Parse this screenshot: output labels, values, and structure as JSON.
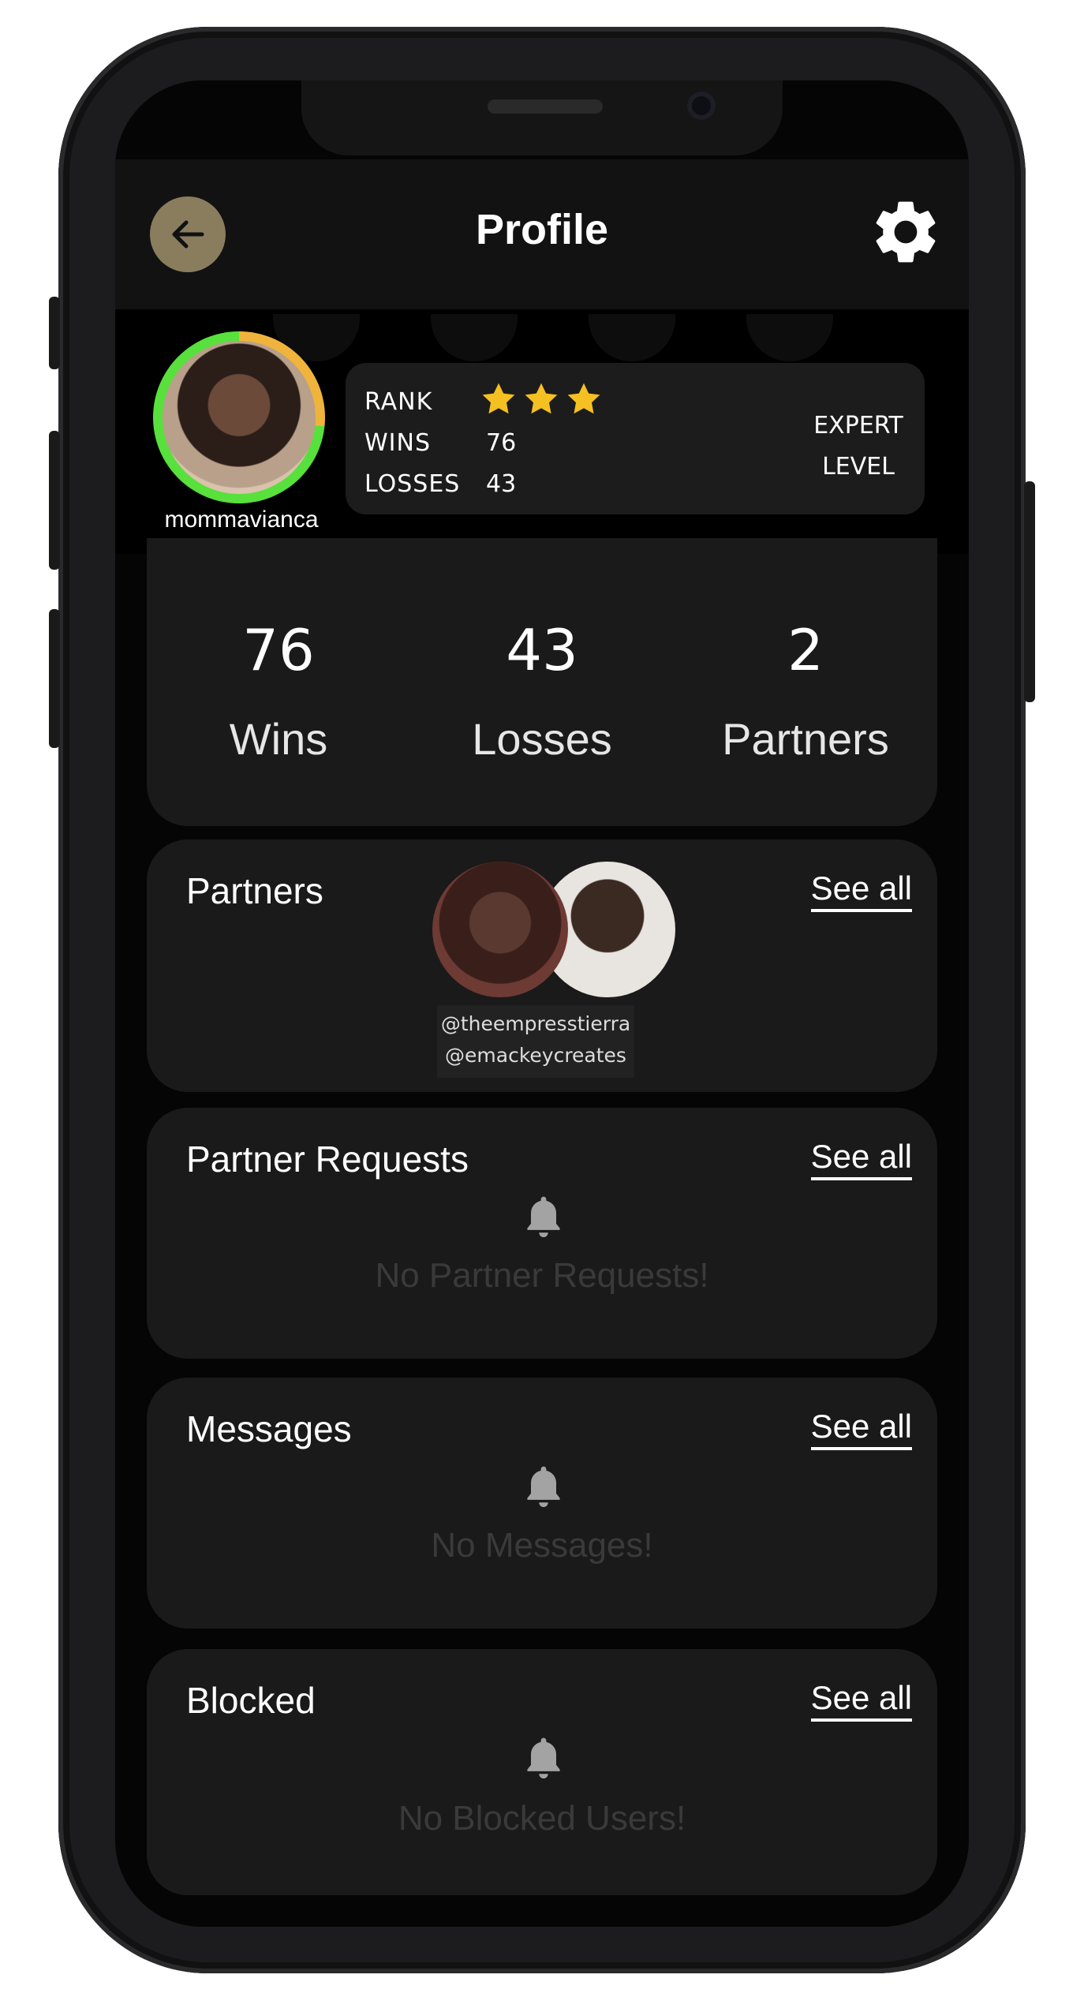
{
  "header": {
    "title": "Profile"
  },
  "profile": {
    "username": "mommavianca",
    "rank_label": "RANK",
    "wins_label": "WINS",
    "wins_value": "76",
    "losses_label": "LOSSES",
    "losses_value": "43",
    "stars": 3,
    "level_line1": "EXPERT",
    "level_line2": "LEVEL"
  },
  "stats": [
    {
      "value": "76",
      "label": "Wins"
    },
    {
      "value": "43",
      "label": "Losses"
    },
    {
      "value": "2",
      "label": "Partners"
    }
  ],
  "partners": {
    "title": "Partners",
    "see_all": "See all",
    "handles": [
      "@theempresstierra",
      "@emackeycreates"
    ]
  },
  "partner_requests": {
    "title": "Partner Requests",
    "see_all": "See all",
    "empty": "No Partner Requests!"
  },
  "messages": {
    "title": "Messages",
    "see_all": "See all",
    "empty": "No Messages!"
  },
  "blocked": {
    "title": "Blocked",
    "see_all": "See all",
    "empty": "No Blocked Users!"
  },
  "colors": {
    "accent_gold": "#8a7d5e",
    "ring_green": "#58e03c",
    "ring_orange": "#f0b43c",
    "star": "#f5c021"
  }
}
